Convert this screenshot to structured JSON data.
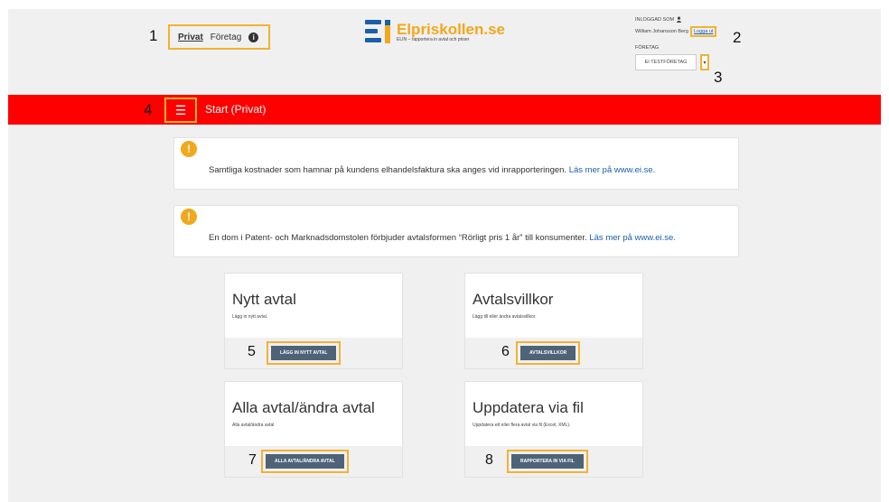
{
  "header": {
    "mode_switch": {
      "private_label": "Privat",
      "company_label": "Företag",
      "info_icon": "info-icon"
    },
    "logo": {
      "name": "Elpriskollen.se",
      "tagline": "ELIN – rapportera in avtal och priser"
    },
    "user": {
      "logged_in_as_label": "INLOGGAD SOM",
      "user_icon": "user-icon",
      "user_name": "William Johansson Berg",
      "logout_label": "Logga ut",
      "company_label": "FÖRETAG",
      "company_value": "EI TESTFÖRETAG"
    }
  },
  "navbar": {
    "menu_icon": "hamburger-menu-icon",
    "title": "Start (Privat)"
  },
  "notices": [
    {
      "icon": "exclamation-icon",
      "text": "Samtliga kostnader som hamnar på kundens elhandelsfaktura ska anges vid inrapporteringen.",
      "link": "Läs mer på www.ei.se."
    },
    {
      "icon": "exclamation-icon",
      "text": "En dom i Patent- och Marknadsdomstolen förbjuder avtalsformen “Rörligt pris 1 år” till konsumenter.",
      "link": "Läs mer på www.ei.se."
    }
  ],
  "cards": [
    {
      "title": "Nytt avtal",
      "description": "Lägg in nytt avtal.",
      "button": "LÄGG IN NYTT AVTAL"
    },
    {
      "title": "Avtalsvillkor",
      "description": "Lägg till eller ändra avtalsvillkor.",
      "button": "AVTALSVILLKOR"
    },
    {
      "title": "Alla avtal/ändra avtal",
      "description": "Alla avtal/ändra avtal",
      "button": "ALLA AVTAL/ÄNDRA AVTAL"
    },
    {
      "title": "Uppdatera via fil",
      "description": "Uppdatera ett eller flera avtal via fil (Excel, XML).",
      "button": "RAPPORTERA IN VIA FIL"
    }
  ],
  "callouts": [
    "1",
    "2",
    "3",
    "4",
    "5",
    "6",
    "7",
    "8"
  ],
  "colors": {
    "navbar": "#ff0000",
    "accent": "#f2a81d",
    "brand_blue": "#1a5fa8",
    "button": "#4e6378",
    "callout_border": "#f2b232"
  }
}
